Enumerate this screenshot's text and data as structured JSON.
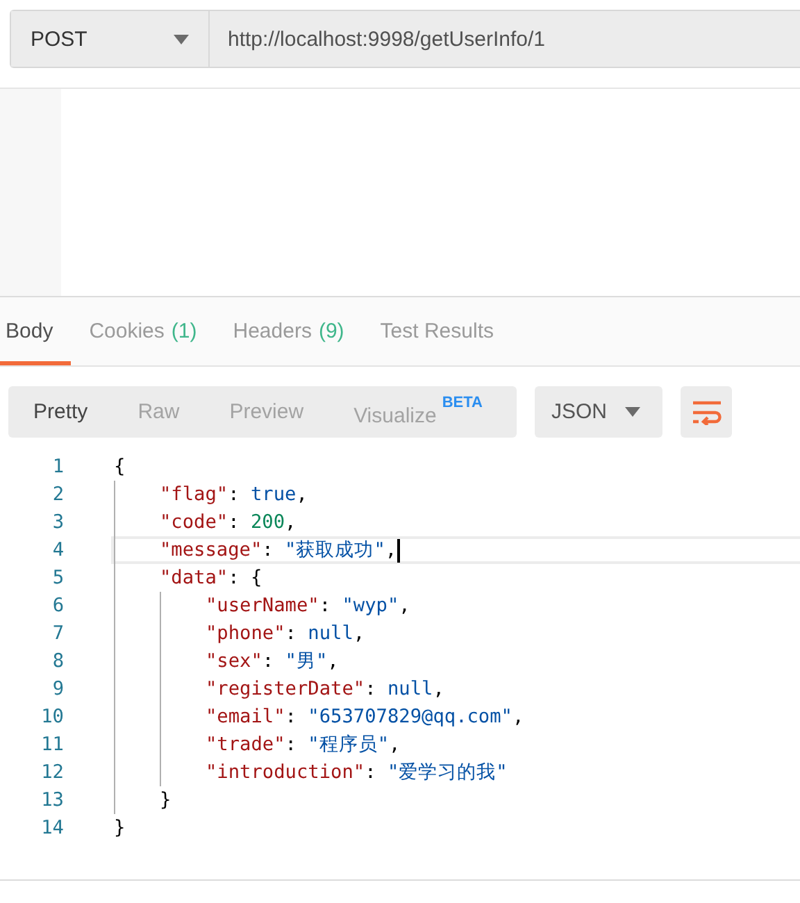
{
  "request": {
    "method": "POST",
    "url": "http://localhost:9998/getUserInfo/1"
  },
  "response_tabs": [
    {
      "label": "Body",
      "selected": true
    },
    {
      "label": "Cookies",
      "count": "(1)",
      "selected": false
    },
    {
      "label": "Headers",
      "count": "(9)",
      "selected": false
    },
    {
      "label": "Test Results",
      "selected": false
    }
  ],
  "view_modes": [
    {
      "label": "Pretty",
      "selected": true
    },
    {
      "label": "Raw",
      "selected": false
    },
    {
      "label": "Preview",
      "selected": false
    },
    {
      "label": "Visualize",
      "badge": "BETA",
      "selected": false
    }
  ],
  "format": "JSON",
  "code": [
    {
      "number": "1",
      "current": false,
      "tokens": [
        {
          "kind": "punct",
          "text": "{"
        }
      ],
      "children": [
        {
          "number": "2",
          "current": false,
          "tokens": [
            {
              "kind": "key",
              "text": "\"flag\""
            },
            {
              "kind": "punct",
              "text": ": "
            },
            {
              "kind": "literal",
              "text": "true"
            },
            {
              "kind": "punct",
              "text": ","
            }
          ]
        },
        {
          "number": "3",
          "current": false,
          "tokens": [
            {
              "kind": "key",
              "text": "\"code\""
            },
            {
              "kind": "punct",
              "text": ": "
            },
            {
              "kind": "number",
              "text": "200"
            },
            {
              "kind": "punct",
              "text": ","
            }
          ]
        },
        {
          "number": "4",
          "current": true,
          "tokens": [
            {
              "kind": "key",
              "text": "\"message\""
            },
            {
              "kind": "punct",
              "text": ": "
            },
            {
              "kind": "string",
              "text": "\"获取成功\""
            },
            {
              "kind": "punct",
              "text": ","
            }
          ]
        },
        {
          "number": "5",
          "current": false,
          "tokens": [
            {
              "kind": "key",
              "text": "\"data\""
            },
            {
              "kind": "punct",
              "text": ": {"
            }
          ],
          "children": [
            {
              "number": "6",
              "current": false,
              "tokens": [
                {
                  "kind": "key",
                  "text": "\"userName\""
                },
                {
                  "kind": "punct",
                  "text": ": "
                },
                {
                  "kind": "string",
                  "text": "\"wyp\""
                },
                {
                  "kind": "punct",
                  "text": ","
                }
              ]
            },
            {
              "number": "7",
              "current": false,
              "tokens": [
                {
                  "kind": "key",
                  "text": "\"phone\""
                },
                {
                  "kind": "punct",
                  "text": ": "
                },
                {
                  "kind": "literal",
                  "text": "null"
                },
                {
                  "kind": "punct",
                  "text": ","
                }
              ]
            },
            {
              "number": "8",
              "current": false,
              "tokens": [
                {
                  "kind": "key",
                  "text": "\"sex\""
                },
                {
                  "kind": "punct",
                  "text": ": "
                },
                {
                  "kind": "string",
                  "text": "\"男\""
                },
                {
                  "kind": "punct",
                  "text": ","
                }
              ]
            },
            {
              "number": "9",
              "current": false,
              "tokens": [
                {
                  "kind": "key",
                  "text": "\"registerDate\""
                },
                {
                  "kind": "punct",
                  "text": ": "
                },
                {
                  "kind": "literal",
                  "text": "null"
                },
                {
                  "kind": "punct",
                  "text": ","
                }
              ]
            },
            {
              "number": "10",
              "current": false,
              "tokens": [
                {
                  "kind": "key",
                  "text": "\"email\""
                },
                {
                  "kind": "punct",
                  "text": ": "
                },
                {
                  "kind": "string",
                  "text": "\"653707829@qq.com\""
                },
                {
                  "kind": "punct",
                  "text": ","
                }
              ]
            },
            {
              "number": "11",
              "current": false,
              "tokens": [
                {
                  "kind": "key",
                  "text": "\"trade\""
                },
                {
                  "kind": "punct",
                  "text": ": "
                },
                {
                  "kind": "string",
                  "text": "\"程序员\""
                },
                {
                  "kind": "punct",
                  "text": ","
                }
              ]
            },
            {
              "number": "12",
              "current": false,
              "tokens": [
                {
                  "kind": "key",
                  "text": "\"introduction\""
                },
                {
                  "kind": "punct",
                  "text": ": "
                },
                {
                  "kind": "string",
                  "text": "\"爱学习的我\""
                }
              ]
            }
          ]
        },
        {
          "number": "13",
          "current": false,
          "tokens": [
            {
              "kind": "punct",
              "text": "}"
            }
          ]
        }
      ]
    },
    {
      "number": "14",
      "current": false,
      "tokens": [
        {
          "kind": "punct",
          "text": "}"
        }
      ]
    }
  ]
}
